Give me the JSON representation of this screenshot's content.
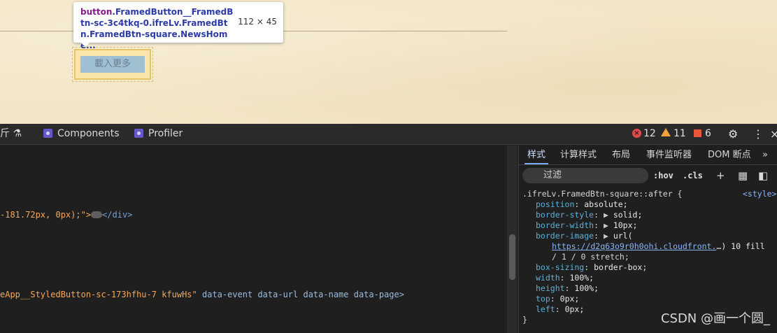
{
  "page": {
    "load_more_label": "載入更多"
  },
  "tooltip": {
    "selector_tag": "button",
    "selector_rest": ".FramedButton__FramedBtn-sc-3c4tkq-0.ifreLv.FramedBtn.FramedBtn-square.NewsHome...",
    "dimensions": "112 × 45"
  },
  "devtools": {
    "left_cut_label": "斤",
    "tabs": [
      {
        "label": "Components"
      },
      {
        "label": "Profiler"
      }
    ],
    "errors": "12",
    "warnings": "11",
    "issues": "6",
    "elements": {
      "line1_value": "-181.72px, 0px);\">",
      "line1_close": "</div>",
      "line2_class": "eApp__StyledButton-sc-173hfhu-7 kfuwHs\"",
      "line2_attrs": " data-event data-url data-name data-page>"
    },
    "styles_tabs": [
      "样式",
      "计算样式",
      "布局",
      "事件监听器",
      "DOM 断点"
    ],
    "more_tabs": "»",
    "filter_placeholder": "过滤",
    "hov": ":hov",
    "cls": ".cls",
    "rule": {
      "selector": ".ifreLv.FramedBtn-square::after {",
      "source": "<style>",
      "declarations": [
        {
          "prop": "position",
          "value": "absolute;"
        },
        {
          "prop": "border-style",
          "value": "solid;",
          "expandable": true
        },
        {
          "prop": "border-width",
          "value": "10px;",
          "expandable": true
        },
        {
          "prop": "border-image",
          "value": "url(",
          "expandable": true
        }
      ],
      "url_text": "https://d2q63o9r0h0ohi.cloudfront.",
      "url_tail": "…) 10 fill",
      "url_cont": "/ 1 / 0 stretch;",
      "declarations2": [
        {
          "prop": "box-sizing",
          "value": "border-box;"
        },
        {
          "prop": "width",
          "value": "100%;"
        },
        {
          "prop": "height",
          "value": "100%;"
        },
        {
          "prop": "top",
          "value": "0px;"
        },
        {
          "prop": "left",
          "value": "0px;"
        }
      ],
      "close": "}"
    }
  },
  "watermark": "CSDN @画一个圆_",
  "colors": {
    "parchment": "#f3e6c6",
    "devtools_bg": "#1f1f1f",
    "accent": "#7cacf8",
    "error": "#e24b4b",
    "warning": "#f2a33a"
  }
}
